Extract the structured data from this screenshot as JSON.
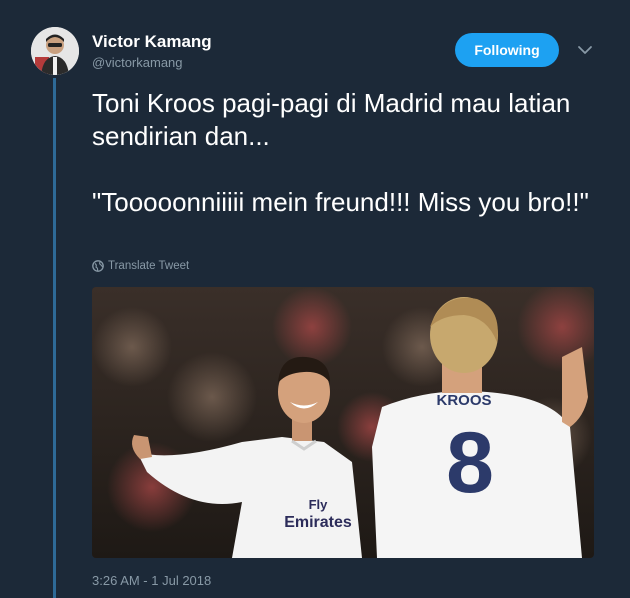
{
  "tweet": {
    "author": {
      "name": "Victor Kamang",
      "handle": "@victorkamang"
    },
    "follow_label": "Following",
    "text": "Toni Kroos pagi-pagi di Madrid mau latian sendirian dan...\n\n\"Tooooonniiiii mein freund!!! Miss you bro!!\"",
    "translate_label": "Translate Tweet",
    "timestamp": "3:26 AM - 1 Jul 2018",
    "media": {
      "jersey_sponsor": "Fly Emirates",
      "back_name": "KROOS",
      "back_number": "8"
    }
  },
  "colors": {
    "background": "#1c2938",
    "accent": "#1da1f2",
    "thread_line": "#2e6a97",
    "muted": "#8899a6"
  },
  "icons": {
    "menu": "chevron-down-icon",
    "translate": "globe-icon"
  }
}
